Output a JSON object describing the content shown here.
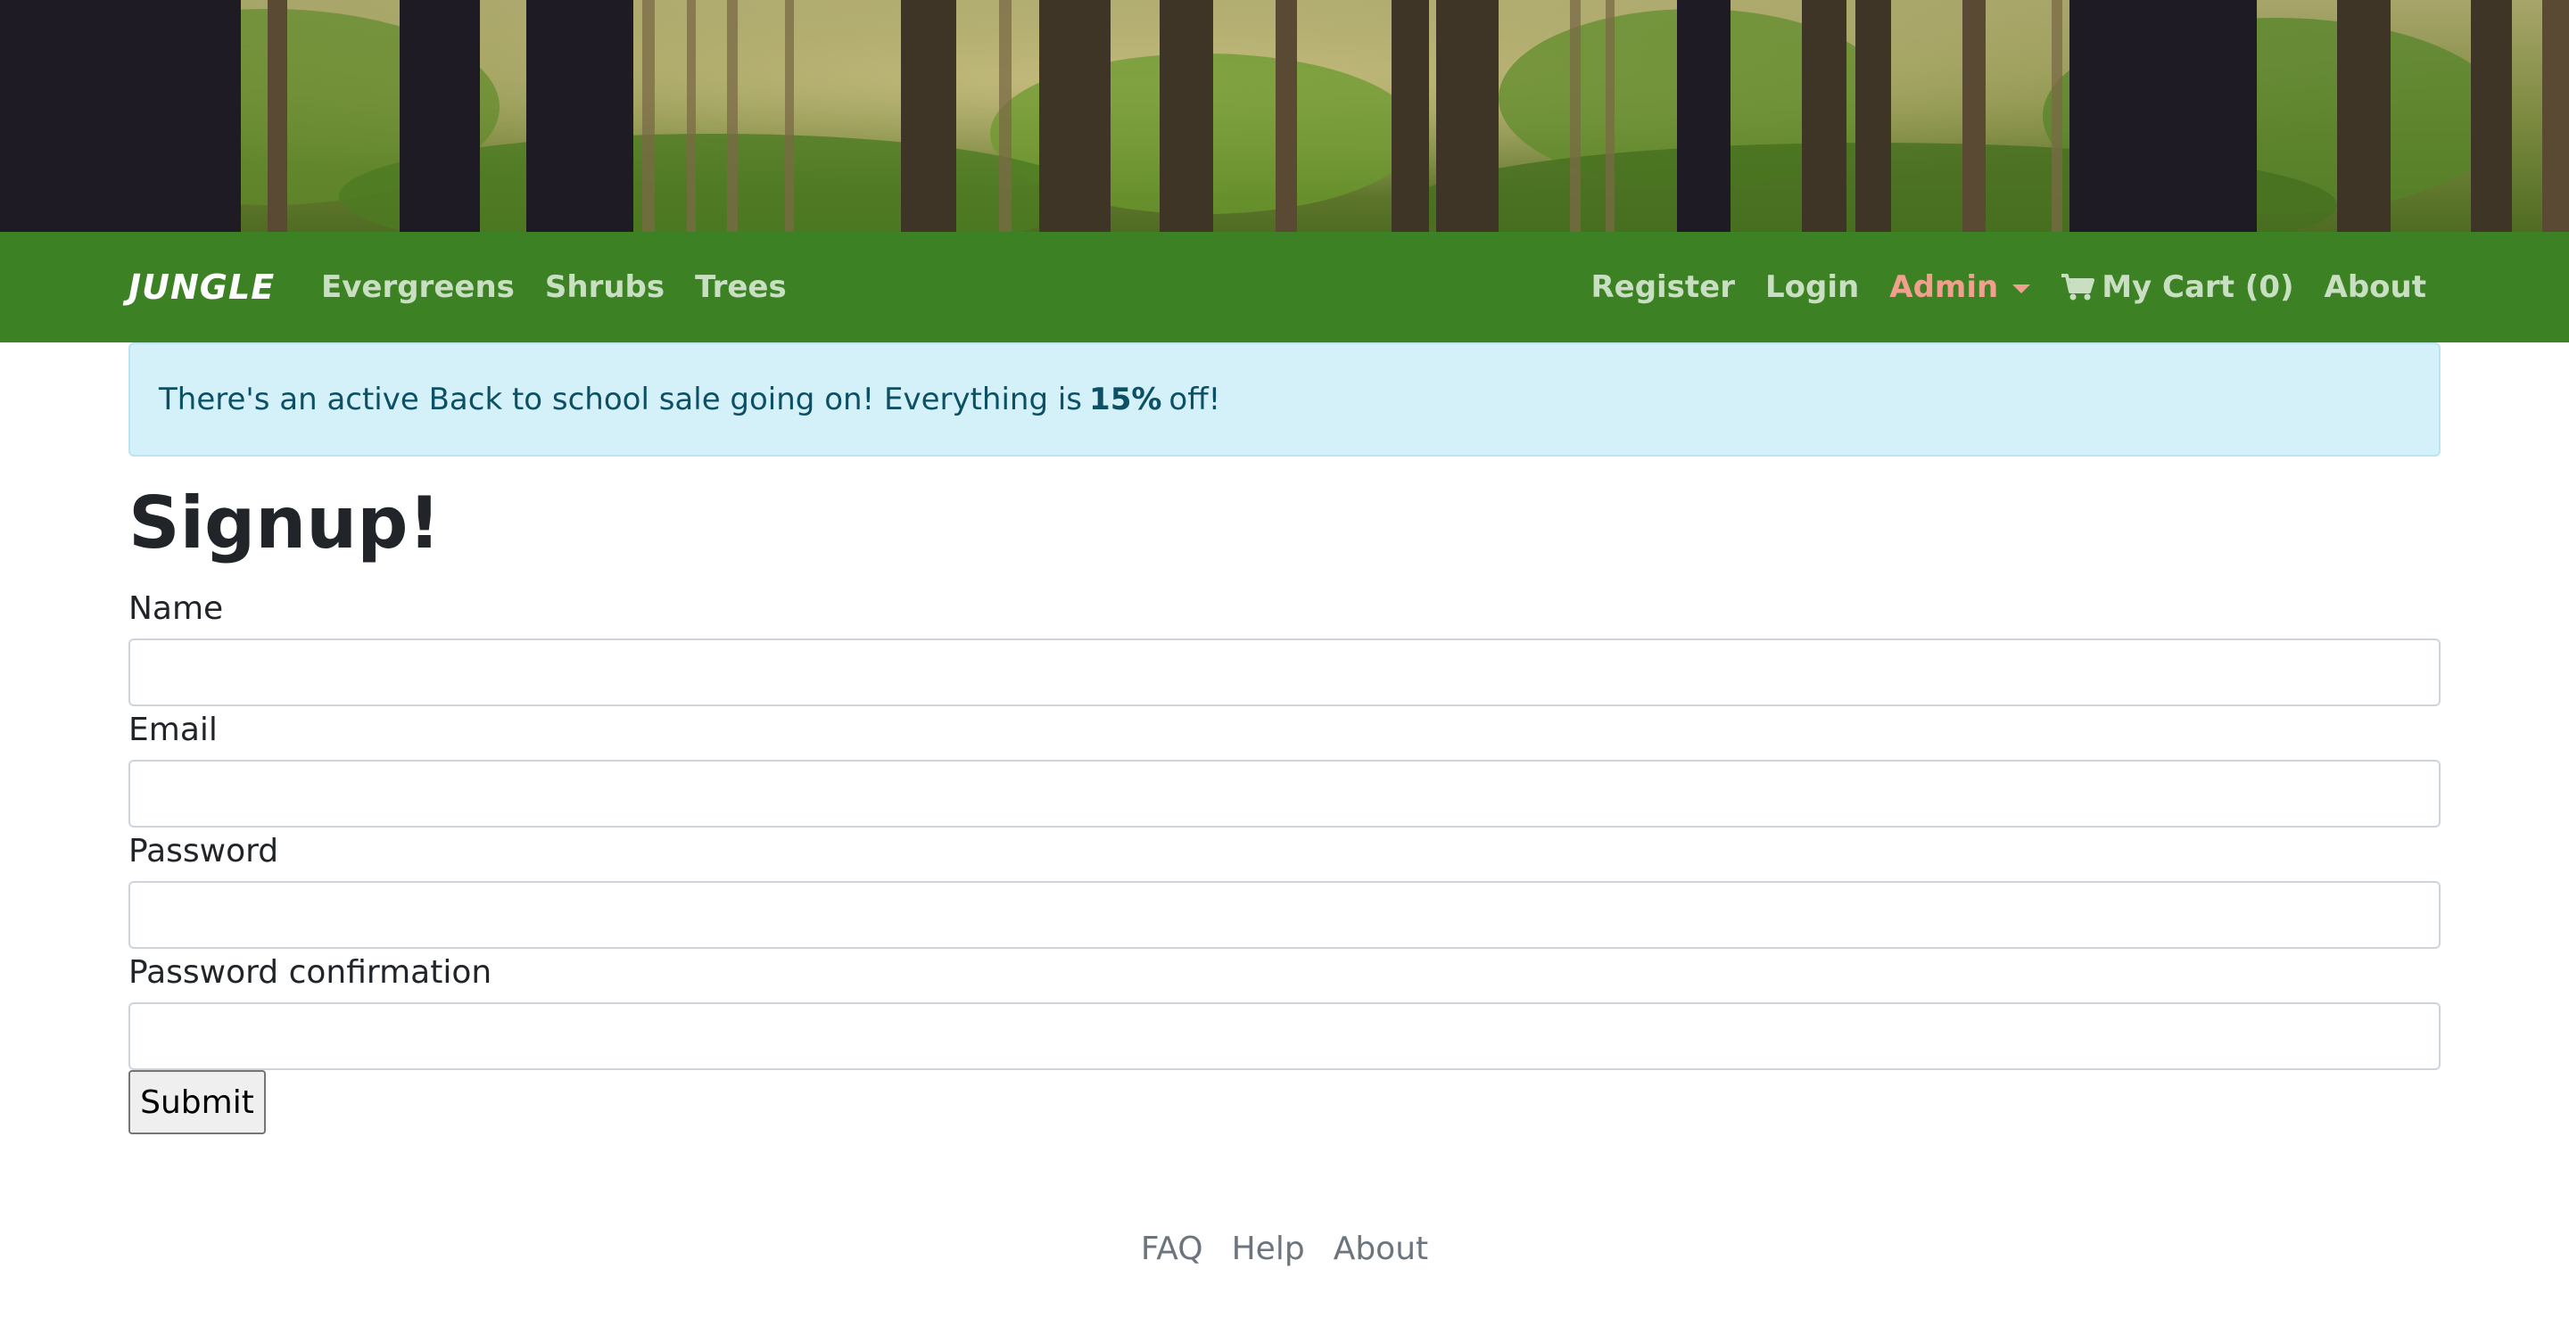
{
  "banner": {
    "image": "forest-header-image"
  },
  "navbar": {
    "brand": "JUNGLE",
    "left_links": [
      "Evergreens",
      "Shrubs",
      "Trees"
    ],
    "register": "Register",
    "login": "Login",
    "admin": "Admin",
    "cart": "My Cart (0)",
    "about": "About"
  },
  "alert": {
    "prefix": "There's an active Back to school sale going on! Everything is",
    "percent": "15%",
    "suffix": "off!"
  },
  "form": {
    "title": "Signup!",
    "name_label": "Name",
    "email_label": "Email",
    "password_label": "Password",
    "password_confirmation_label": "Password confirmation",
    "submit_label": "Submit"
  },
  "footer": {
    "links": [
      "FAQ",
      "Help",
      "About"
    ]
  },
  "colors": {
    "navbar": "#3c8224",
    "nav_link": "#c9dfc2",
    "admin_link": "#f0a08c",
    "alert_bg": "#d4f0f8",
    "alert_text": "#0b5064"
  }
}
